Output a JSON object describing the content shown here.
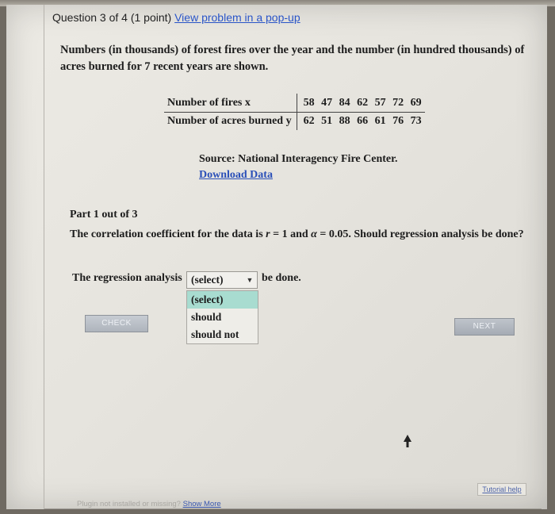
{
  "header": {
    "question_label": "Question 3 of 4 (1 point)",
    "popup_link": "View problem in a pop-up"
  },
  "problem": {
    "prompt": "Numbers (in thousands) of forest fires over the year and the number (in hundred thousands) of acres burned for 7 recent years are shown.",
    "table": {
      "row1_label": "Number of fires x",
      "row1_values": "58 47 84 62 57 72 69",
      "row2_label": "Number of acres burned y",
      "row2_values": "62 51 88 66 61 76 73"
    },
    "source": "Source: National Interagency Fire Center.",
    "download_link": "Download Data"
  },
  "part": {
    "label": "Part 1 out of 3",
    "question_a": "The correlation coefficient for the data is ",
    "question_r": "r",
    "question_b": " = 1 and ",
    "question_alpha": "α",
    "question_c": " = 0.05. Should regression analysis be done?"
  },
  "answer": {
    "prefix": "The regression analysis",
    "selected": "(select)",
    "suffix": "be done.",
    "options": [
      "(select)",
      "should",
      "should not"
    ]
  },
  "buttons": {
    "check": "CHECK",
    "next": "NEXT",
    "tutorial": "Tutorial help"
  },
  "footer": {
    "plugin_text": "Plugin not installed or missing?",
    "show_more": "Show More"
  },
  "colors": {
    "link": "#2a55c8",
    "selected_option": "#a8dcd0",
    "button": "#b8bdc4"
  }
}
